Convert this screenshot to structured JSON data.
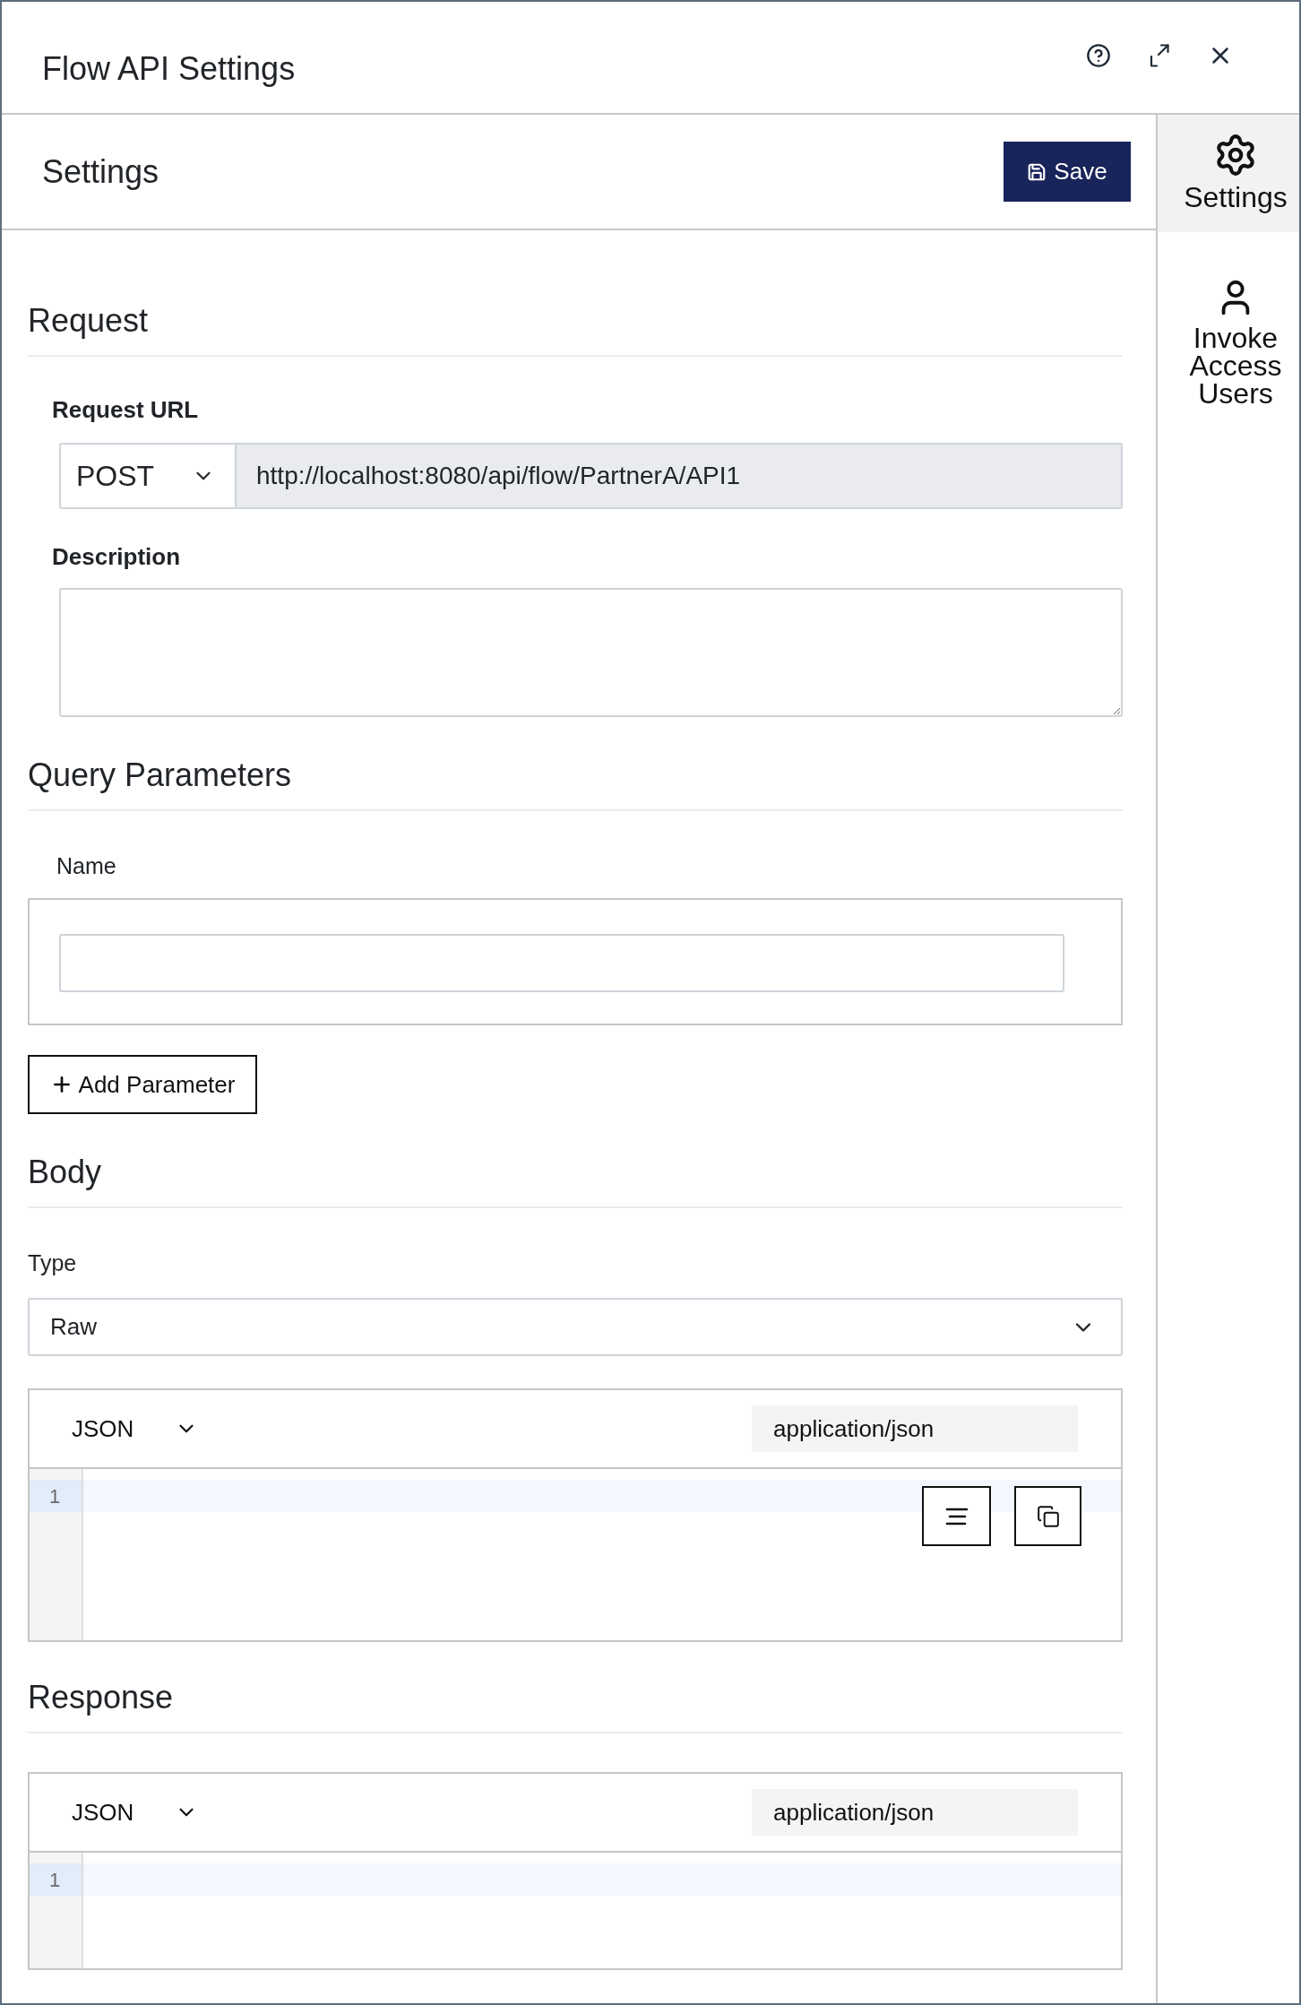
{
  "window": {
    "title": "Flow API Settings"
  },
  "toolbar": {
    "title": "Settings",
    "save_label": "Save"
  },
  "side_tabs": [
    {
      "kind": "settings",
      "label": "Settings",
      "selected": true
    },
    {
      "kind": "users",
      "label": "Invoke Access Users",
      "selected": false
    }
  ],
  "request": {
    "heading": "Request",
    "url_label": "Request URL",
    "method": "POST",
    "url": "http://localhost:8080/api/flow/PartnerA/API1",
    "description_label": "Description"
  },
  "query_parameters": {
    "heading": "Query Parameters",
    "columns": [
      "Name"
    ],
    "add_label": "Add Parameter"
  },
  "body": {
    "heading": "Body",
    "type_label": "Type",
    "type": "Raw",
    "editor": {
      "language": "JSON",
      "content_type": "application/json",
      "lines": [
        {
          "number": "1",
          "active": true
        }
      ],
      "actions": true
    }
  },
  "response": {
    "heading": "Response",
    "editor": {
      "language": "JSON",
      "content_type": "application/json",
      "lines": [
        {
          "number": "1",
          "active": true
        }
      ]
    }
  }
}
